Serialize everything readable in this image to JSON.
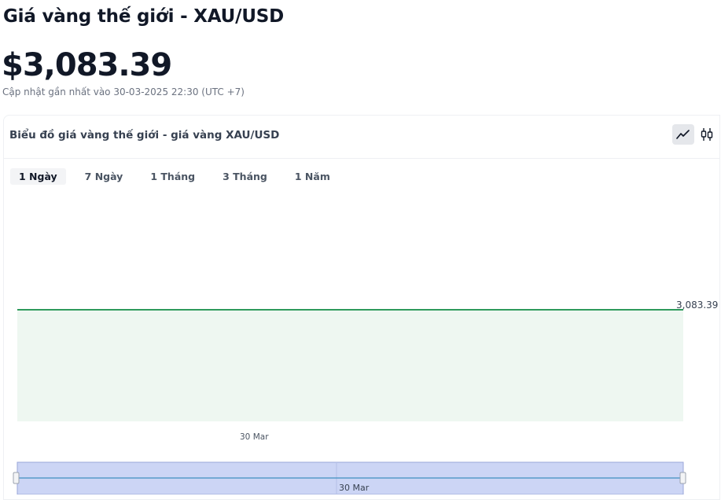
{
  "header": {
    "title": "Giá vàng thế giới - XAU/USD",
    "price": "$3,083.39",
    "updated": "Cập nhật gần nhất vào 30-03-2025 22:30 (UTC +7)"
  },
  "card": {
    "title": "Biểu đồ giá vàng thế giới - giá vàng XAU/USD",
    "chart_types": [
      {
        "name": "line",
        "icon": "line-chart-icon",
        "active": true
      },
      {
        "name": "candlestick",
        "icon": "candlestick-icon",
        "active": false
      }
    ],
    "range_tabs": [
      {
        "label": "1 Ngày",
        "active": true
      },
      {
        "label": "7 Ngày",
        "active": false
      },
      {
        "label": "1 Tháng",
        "active": false
      },
      {
        "label": "3 Tháng",
        "active": false
      },
      {
        "label": "1 Năm",
        "active": false
      }
    ]
  },
  "chart": {
    "current_price_label": "3,083.39",
    "x_tick": "30 Mar",
    "navigator_label": "30 Mar"
  },
  "colors": {
    "line": "#2e9a5c",
    "area_fill": "#eef7f1",
    "navigator_fill": "#ccd5f5",
    "navigator_line": "#3f8fc0"
  },
  "chart_data": {
    "type": "area",
    "x": [
      "30 Mar"
    ],
    "series": [
      {
        "values": [
          3083.39
        ]
      }
    ],
    "title": "",
    "xlabel": "",
    "ylabel": "",
    "legend": "none",
    "grid": false
  }
}
